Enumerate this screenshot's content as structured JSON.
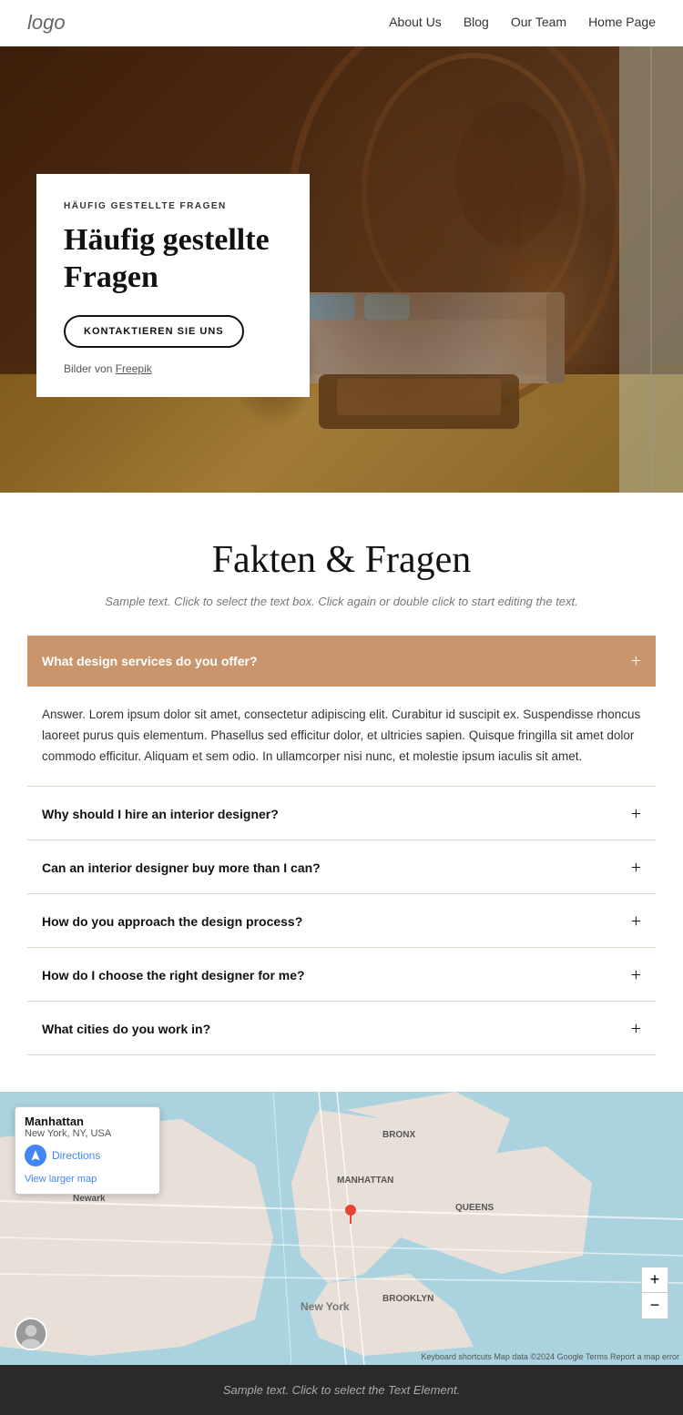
{
  "nav": {
    "logo": "logo",
    "links": [
      {
        "label": "About Us",
        "href": "#"
      },
      {
        "label": "Blog",
        "href": "#"
      },
      {
        "label": "Our Team",
        "href": "#"
      },
      {
        "label": "Home Page",
        "href": "#"
      }
    ]
  },
  "hero": {
    "subtitle": "HÄUFIG GESTELLTE FRAGEN",
    "title": "Häufig gestellte Fragen",
    "btn_label": "KONTAKTIEREN SIE UNS",
    "credit_text": "Bilder von",
    "credit_link": "Freepik"
  },
  "faq_section": {
    "title": "Fakten & Fragen",
    "sample_text": "Sample text. Click to select the text box. Click again or double click to start editing the text.",
    "items": [
      {
        "question": "What design services do you offer?",
        "answer": "Answer. Lorem ipsum dolor sit amet, consectetur adipiscing elit. Curabitur id suscipit ex. Suspendisse rhoncus laoreet purus quis elementum. Phasellus sed efficitur dolor, et ultricies sapien. Quisque fringilla sit amet dolor commodo efficitur. Aliquam et sem odio. In ullamcorper nisi nunc, et molestie ipsum iaculis sit amet.",
        "open": true
      },
      {
        "question": "Why should I hire an interior designer?",
        "answer": "",
        "open": false
      },
      {
        "question": "Can an interior designer buy more than I can?",
        "answer": "",
        "open": false
      },
      {
        "question": "How do you approach the design process?",
        "answer": "",
        "open": false
      },
      {
        "question": "How do I choose the right designer for me?",
        "answer": "",
        "open": false
      },
      {
        "question": "What cities do you work in?",
        "answer": "",
        "open": false
      }
    ]
  },
  "map": {
    "location_title": "Manhattan",
    "location_sub": "New York, NY, USA",
    "directions_label": "Directions",
    "larger_map_label": "View larger map",
    "attribution": "Keyboard shortcuts  Map data ©2024 Google  Terms  Report a map error",
    "zoom_in": "+",
    "zoom_out": "−"
  },
  "footer": {
    "text": "Sample text. Click to select the Text Element."
  }
}
